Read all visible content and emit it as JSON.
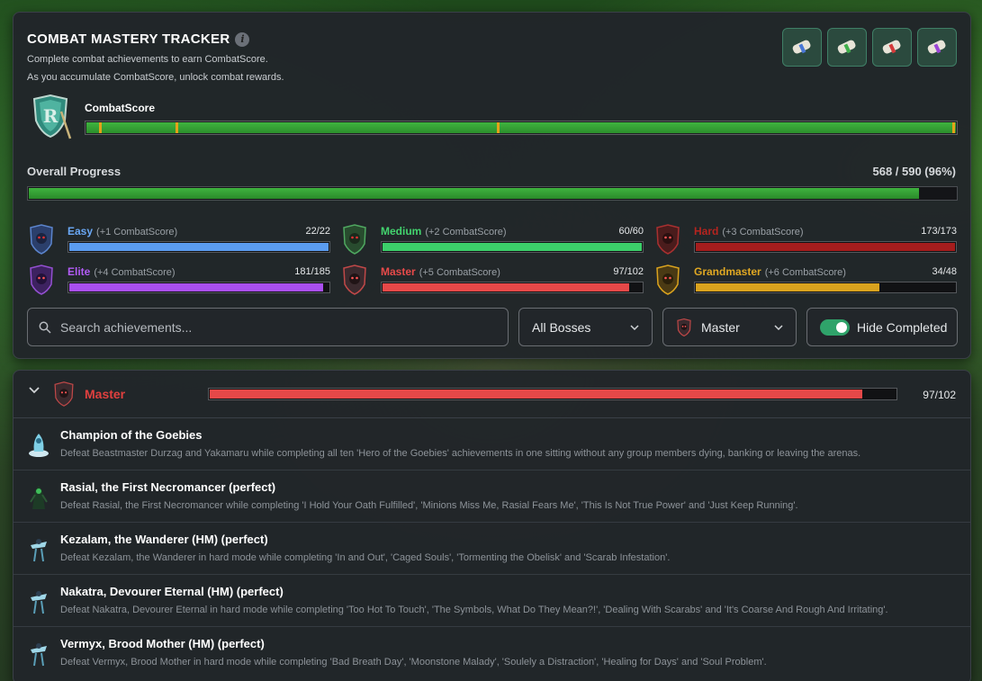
{
  "header": {
    "title": "COMBAT MASTERY TRACKER",
    "subtitle_1": "Complete combat achievements to earn CombatScore.",
    "subtitle_2": "As you accumulate CombatScore, unlock combat rewards."
  },
  "scroll_rewards": [
    {
      "icon": "scroll-blue-icon",
      "color": "#4a78d6"
    },
    {
      "icon": "scroll-green-icon",
      "color": "#3fae4a"
    },
    {
      "icon": "scroll-red-icon",
      "color": "#d43a3a"
    },
    {
      "icon": "scroll-purple-icon",
      "color": "#9a46d6"
    }
  ],
  "combat_score": {
    "label": "CombatScore",
    "progress": 1.0
  },
  "overall": {
    "label": "Overall Progress",
    "value_text": "568 / 590 (96%)",
    "progress": 0.96
  },
  "tiers": [
    {
      "name": "Easy",
      "bonus": "(+1 CombatScore)",
      "count": "22/22",
      "progress": 1.0,
      "color": "#5b9cf0",
      "name_color": "#6aa8f5"
    },
    {
      "name": "Medium",
      "bonus": "(+2 CombatScore)",
      "count": "60/60",
      "progress": 1.0,
      "color": "#3ccf6a",
      "name_color": "#43d46e"
    },
    {
      "name": "Hard",
      "bonus": "(+3 CombatScore)",
      "count": "173/173",
      "progress": 1.0,
      "color": "#a51d1d",
      "name_color": "#b5241f"
    },
    {
      "name": "Elite",
      "bonus": "(+4 CombatScore)",
      "count": "181/185",
      "progress": 0.978,
      "color": "#a94ff0",
      "name_color": "#b25cf5"
    },
    {
      "name": "Master",
      "bonus": "(+5 CombatScore)",
      "count": "97/102",
      "progress": 0.951,
      "color": "#e54848",
      "name_color": "#e84a4a"
    },
    {
      "name": "Grandmaster",
      "bonus": "(+6 CombatScore)",
      "count": "34/48",
      "progress": 0.708,
      "color": "#d9a21e",
      "name_color": "#e0a823"
    }
  ],
  "filters": {
    "search_placeholder": "Search achievements...",
    "bosses_value": "All Bosses",
    "tier_value": "Master",
    "hide_completed_label": "Hide Completed",
    "hide_completed_on": true
  },
  "group": {
    "name": "Master",
    "count": "97/102",
    "progress": 0.951
  },
  "achievements": [
    {
      "title": "Champion of the Goebies",
      "description": "Defeat Beastmaster Durzag and Yakamaru while completing all ten 'Hero of the Goebies' achievements in one sitting without any group members dying, banking or leaving the arenas.",
      "icon": "goebie-champion-icon"
    },
    {
      "title": "Rasial, the First Necromancer (perfect)",
      "description": "Defeat Rasial, the First Necromancer while completing 'I Hold Your Oath Fulfilled', 'Minions Miss Me, Rasial Fears Me', 'This Is Not True Power' and 'Just Keep Running'.",
      "icon": "rasial-icon"
    },
    {
      "title": "Kezalam, the Wanderer (HM) (perfect)",
      "description": "Defeat Kezalam, the Wanderer in hard mode while completing 'In and Out', 'Caged Souls', 'Tormenting the Obelisk' and 'Scarab Infestation'.",
      "icon": "kezalam-icon"
    },
    {
      "title": "Nakatra, Devourer Eternal (HM) (perfect)",
      "description": "Defeat Nakatra, Devourer Eternal in hard mode while completing 'Too Hot To Touch', 'The Symbols, What Do They Mean?!', 'Dealing With Scarabs' and 'It's Coarse And Rough And Irritating'.",
      "icon": "nakatra-icon"
    },
    {
      "title": "Vermyx, Brood Mother (HM) (perfect)",
      "description": "Defeat Vermyx, Brood Mother in hard mode while completing 'Bad Breath Day', 'Moonstone Malady', 'Soulely a Distraction', 'Healing for Days' and 'Soul Problem'.",
      "icon": "vermyx-icon"
    }
  ]
}
